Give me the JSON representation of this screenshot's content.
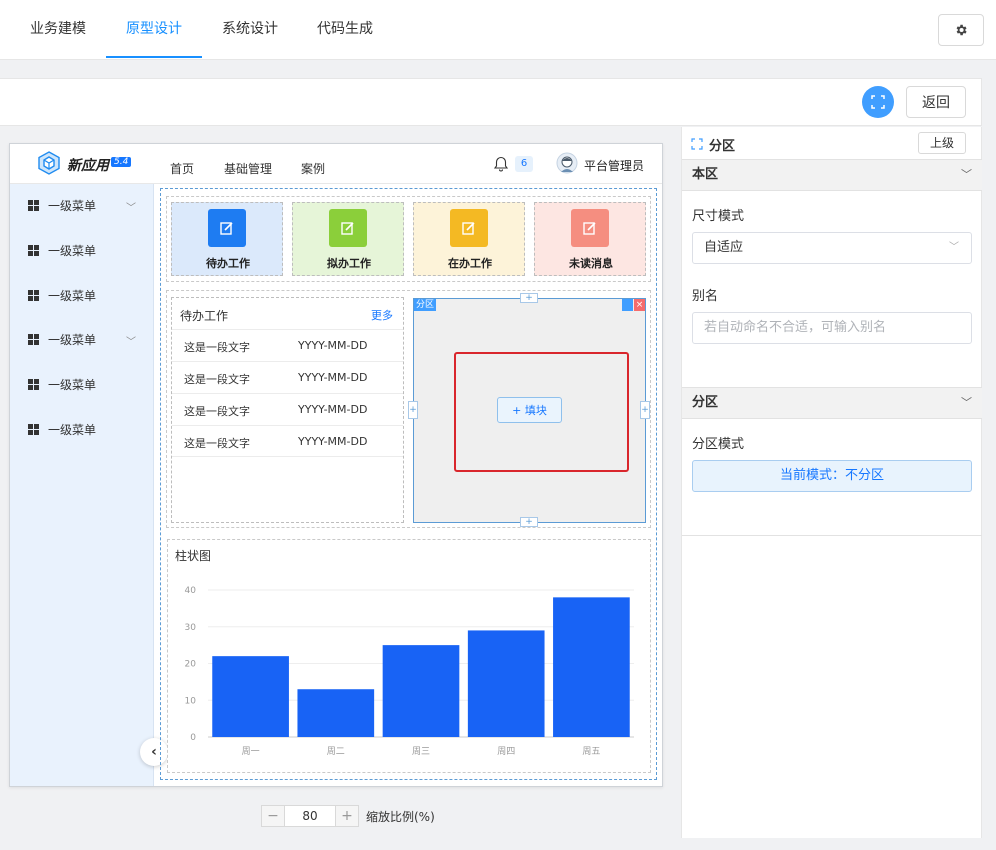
{
  "topnav": {
    "tabs": [
      {
        "label": "业务建模"
      },
      {
        "label": "原型设计"
      },
      {
        "label": "系统设计"
      },
      {
        "label": "代码生成"
      }
    ],
    "active_index": 1
  },
  "toolbar": {
    "back_label": "返回",
    "fullscreen_icon": "fullscreen-icon"
  },
  "preview": {
    "app_title": "新应用",
    "version": "5.4",
    "nav": [
      "首页",
      "基础管理",
      "案例"
    ],
    "notifications": "6",
    "user_name": "平台管理员",
    "sidebar": [
      {
        "label": "一级菜单",
        "has_children": true
      },
      {
        "label": "一级菜单",
        "has_children": false
      },
      {
        "label": "一级菜单",
        "has_children": false
      },
      {
        "label": "一级菜单",
        "has_children": true
      },
      {
        "label": "一级菜单",
        "has_children": false
      },
      {
        "label": "一级菜单",
        "has_children": false
      }
    ],
    "tiles": [
      {
        "label": "待办工作",
        "color": "#1e7cf2",
        "bg": "#dbe9fb"
      },
      {
        "label": "拟办工作",
        "color": "#8bcf3a",
        "bg": "#e6f5d8"
      },
      {
        "label": "在办工作",
        "color": "#f4b923",
        "bg": "#fdf3d9"
      },
      {
        "label": "未读消息",
        "color": "#f58e80",
        "bg": "#fde6e2"
      }
    ],
    "todo": {
      "title": "待办工作",
      "more": "更多",
      "rows": [
        {
          "text": "这是一段文字",
          "date": "YYYY-MM-DD"
        },
        {
          "text": "这是一段文字",
          "date": "YYYY-MM-DD"
        },
        {
          "text": "这是一段文字",
          "date": "YYYY-MM-DD"
        },
        {
          "text": "这是一段文字",
          "date": "YYYY-MM-DD"
        }
      ]
    },
    "partition": {
      "tag": "分区",
      "fill_label": "+ 填块"
    },
    "chart_title": "柱状图"
  },
  "chart_data": {
    "type": "bar",
    "categories": [
      "周一",
      "周二",
      "周三",
      "周四",
      "周五"
    ],
    "values": [
      22,
      13,
      25,
      29,
      38
    ],
    "ylim": [
      0,
      40
    ],
    "yticks": [
      0,
      10,
      20,
      30,
      40
    ],
    "color": "#1863f5",
    "grid": true
  },
  "zoom": {
    "minus": "−",
    "value": "80",
    "plus": "+",
    "label": "缩放比例(%)"
  },
  "rpanel": {
    "title": "分区",
    "parent_label": "上级",
    "section1": "本区",
    "size_mode_label": "尺寸模式",
    "size_mode_value": "自适应",
    "alias_label": "别名",
    "alias_placeholder": "若自动命名不合适，可输入别名",
    "section2": "分区",
    "partition_mode_label": "分区模式",
    "partition_mode_value": "当前模式：不分区"
  }
}
